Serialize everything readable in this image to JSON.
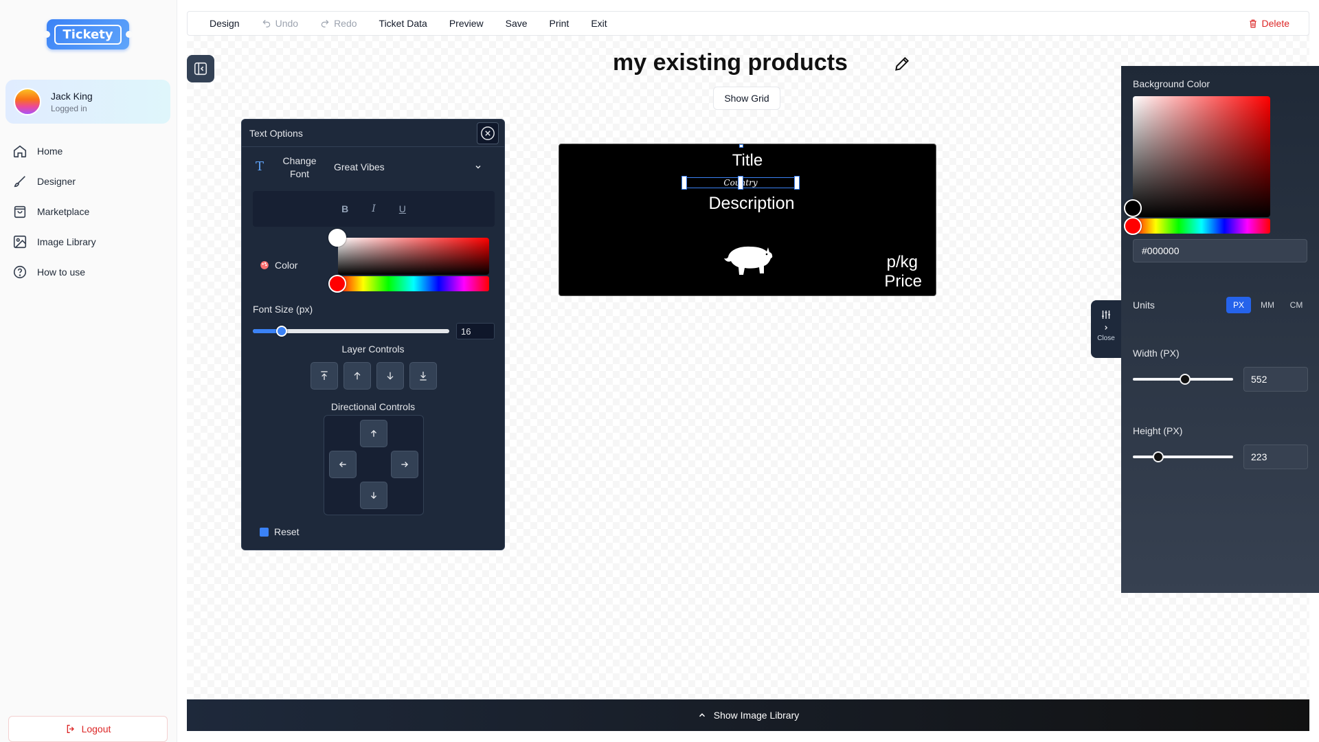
{
  "app": {
    "logo_text": "Tickety"
  },
  "user": {
    "name": "Jack King",
    "status": "Logged in"
  },
  "sidebar": {
    "items": [
      {
        "label": "Home",
        "icon": "home-icon"
      },
      {
        "label": "Designer",
        "icon": "brush-icon"
      },
      {
        "label": "Marketplace",
        "icon": "shopping-bag-icon"
      },
      {
        "label": "Image Library",
        "icon": "image-icon"
      },
      {
        "label": "How to use",
        "icon": "help-circle-icon"
      }
    ],
    "logout_label": "Logout"
  },
  "toolbar": {
    "design": "Design",
    "undo": "Undo",
    "redo": "Redo",
    "ticket_data": "Ticket Data",
    "preview": "Preview",
    "save": "Save",
    "print": "Print",
    "exit": "Exit",
    "delete": "Delete"
  },
  "page": {
    "title": "my existing products",
    "show_grid_label": "Show Grid"
  },
  "text_options": {
    "title": "Text Options",
    "change_font_label": "Change Font",
    "font_value": "Great Vibes",
    "bold": "B",
    "italic": "I",
    "underline": "U",
    "color_label": "Color",
    "font_size_label": "Font Size (px)",
    "font_size_value": "16",
    "layer_controls_label": "Layer Controls",
    "directional_controls_label": "Directional Controls",
    "reset_label": "Reset"
  },
  "ticket": {
    "title": "Title",
    "country": "Country",
    "description": "Description",
    "unit": "p/kg",
    "price": "Price",
    "background": "#000000"
  },
  "right_panel": {
    "background_color_label": "Background Color",
    "hex_value": "#000000",
    "units_label": "Units",
    "units": [
      "PX",
      "MM",
      "CM"
    ],
    "active_unit": "PX",
    "width_label": "Width (PX)",
    "width_value": "552",
    "height_label": "Height (PX)",
    "height_value": "223",
    "close_label": "Close"
  },
  "bottom_bar": {
    "label": "Show Image Library"
  },
  "colors": {
    "accent": "#2563eb",
    "danger": "#dc2626",
    "panel": "#1e293b"
  }
}
